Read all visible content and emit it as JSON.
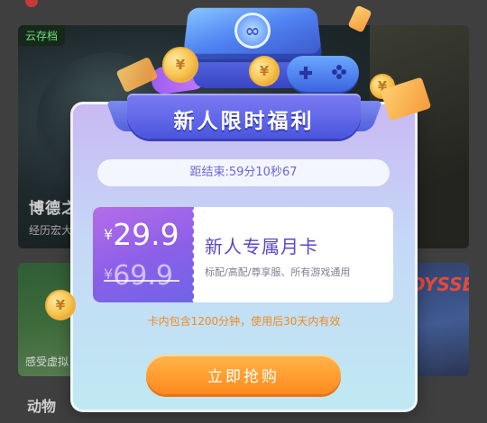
{
  "background": {
    "cloud_tag": "云存档",
    "top_card_title": "博德之",
    "top_card_sub": "经历宏大",
    "bottom_left_sub": "感受虚拟",
    "bottom_right_logo": "ODYSSEY",
    "section_label": "动物"
  },
  "modal": {
    "title": "新人限时福利",
    "countdown": "距结束:59分10秒67",
    "offer": {
      "currency": "¥",
      "price_now": "29.9",
      "price_old": "69.9",
      "name": "新人专属月卡",
      "desc": "标配/高配/尊享服、所有游戏通用"
    },
    "note": "卡内包含1200分钟，使用后30天内有效",
    "buy_label": "立即抢购"
  },
  "colors": {
    "accent_purple": "#5a47c9",
    "button_orange": "#ff8a1e",
    "note_orange": "#f08a23"
  }
}
